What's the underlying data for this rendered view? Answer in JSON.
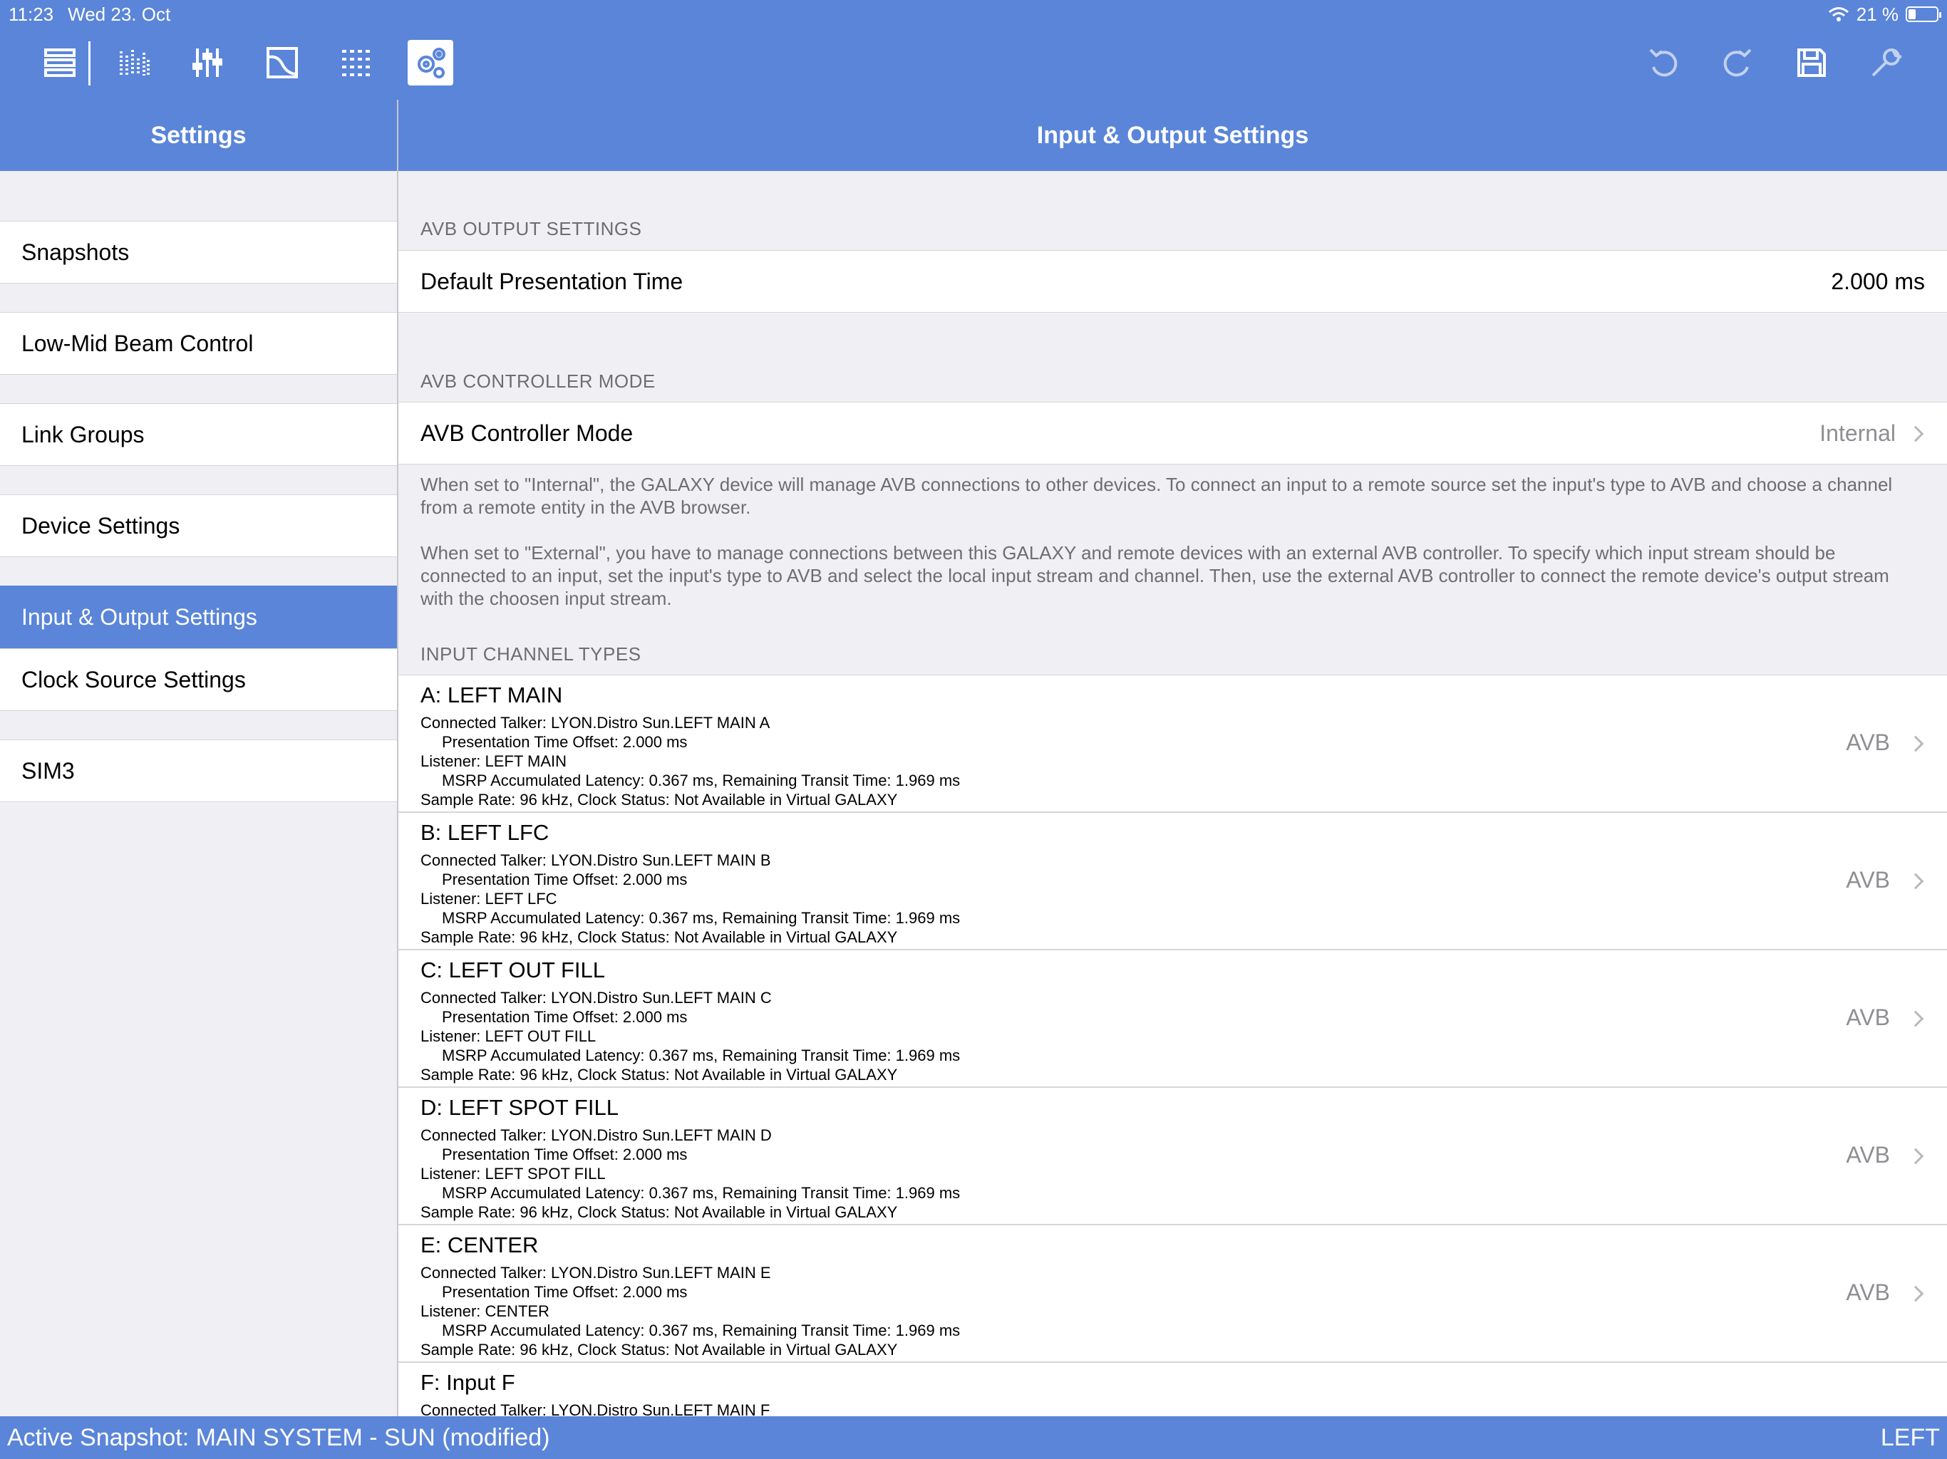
{
  "status_bar": {
    "time": "11:23",
    "date": "Wed 23. Oct",
    "battery": "21 %"
  },
  "toolbar": {
    "icons": [
      "devices-list-icon",
      "meters-icon",
      "faders-icon",
      "eq-curve-icon",
      "grid-icon",
      "settings-gears-icon",
      "undo-icon",
      "redo-icon",
      "save-icon",
      "wrench-icon"
    ],
    "active": "settings-gears-icon"
  },
  "sidebar": {
    "title": "Settings",
    "items": [
      {
        "label": "Snapshots"
      },
      {
        "label": "Low-Mid Beam Control"
      },
      {
        "label": "Link Groups"
      },
      {
        "label": "Device Settings"
      },
      {
        "label": "Input & Output Settings",
        "selected": true
      },
      {
        "label": "Clock Source Settings"
      },
      {
        "label": "SIM3"
      }
    ]
  },
  "main": {
    "title": "Input & Output Settings",
    "avb_output": {
      "header": "AVB OUTPUT SETTINGS",
      "label": "Default Presentation Time",
      "value": "2.000 ms"
    },
    "avb_controller": {
      "header": "AVB CONTROLLER MODE",
      "label": "AVB Controller Mode",
      "value": "Internal",
      "note1": "When set to \"Internal\", the GALAXY device will manage AVB connections to other devices. To connect an input to a remote source set the input's type to AVB and choose a channel from a remote entity in the AVB browser.",
      "note2": "When set to \"External\", you have to manage connections between this GALAXY and remote devices with an external AVB controller. To specify which input stream should be connected to an input, set the input's type to AVB and select the local input stream and channel. Then, use the external AVB controller to connect the remote device's output stream with the choosen input stream."
    },
    "input_channels": {
      "header": "INPUT CHANNEL TYPES",
      "channels": [
        {
          "title": "A: LEFT MAIN",
          "talker": "Connected Talker: LYON.Distro Sun.LEFT MAIN A",
          "offset": "Presentation Time Offset: 2.000 ms",
          "listener": "Listener: LEFT MAIN",
          "latency": "MSRP Accumulated Latency: 0.367 ms, Remaining Transit Time: 1.969 ms",
          "sample": "Sample Rate: 96 kHz, Clock Status: Not Available in Virtual GALAXY",
          "type": "AVB"
        },
        {
          "title": "B: LEFT LFC",
          "talker": "Connected Talker: LYON.Distro Sun.LEFT MAIN B",
          "offset": "Presentation Time Offset: 2.000 ms",
          "listener": "Listener: LEFT LFC",
          "latency": "MSRP Accumulated Latency: 0.367 ms, Remaining Transit Time: 1.969 ms",
          "sample": "Sample Rate: 96 kHz, Clock Status: Not Available in Virtual GALAXY",
          "type": "AVB"
        },
        {
          "title": "C: LEFT OUT FILL",
          "talker": "Connected Talker: LYON.Distro Sun.LEFT MAIN C",
          "offset": "Presentation Time Offset: 2.000 ms",
          "listener": "Listener: LEFT OUT FILL",
          "latency": "MSRP Accumulated Latency: 0.367 ms, Remaining Transit Time: 1.969 ms",
          "sample": "Sample Rate: 96 kHz, Clock Status: Not Available in Virtual GALAXY",
          "type": "AVB"
        },
        {
          "title": "D: LEFT SPOT FILL",
          "talker": "Connected Talker: LYON.Distro Sun.LEFT MAIN D",
          "offset": "Presentation Time Offset: 2.000 ms",
          "listener": "Listener: LEFT SPOT FILL",
          "latency": "MSRP Accumulated Latency: 0.367 ms, Remaining Transit Time: 1.969 ms",
          "sample": "Sample Rate: 96 kHz, Clock Status: Not Available in Virtual GALAXY",
          "type": "AVB"
        },
        {
          "title": "E: CENTER",
          "talker": "Connected Talker: LYON.Distro Sun.LEFT MAIN E",
          "offset": "Presentation Time Offset: 2.000 ms",
          "listener": "Listener: CENTER",
          "latency": "MSRP Accumulated Latency: 0.367 ms, Remaining Transit Time: 1.969 ms",
          "sample": "Sample Rate: 96 kHz, Clock Status: Not Available in Virtual GALAXY",
          "type": "AVB"
        },
        {
          "title": "F: Input F",
          "talker": "Connected Talker: LYON.Distro Sun.LEFT MAIN F"
        }
      ]
    }
  },
  "bottom_bar": {
    "snapshot": "Active Snapshot: MAIN SYSTEM - SUN (modified)",
    "side": "LEFT"
  },
  "colors": {
    "accent": "#5a85d9",
    "background": "#efeff4",
    "secondary_text": "#6d6d72"
  }
}
